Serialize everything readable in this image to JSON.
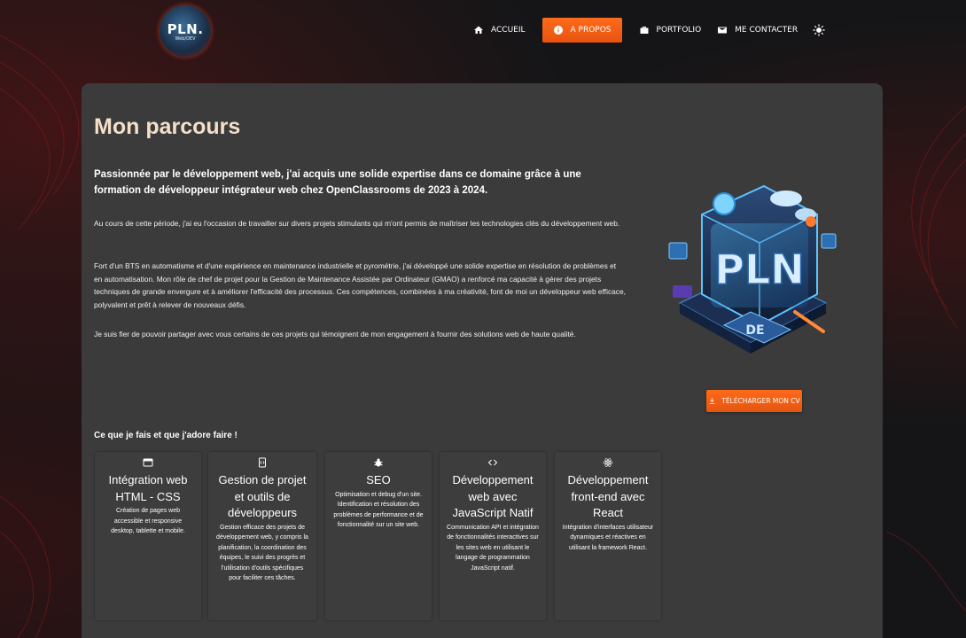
{
  "logo": {
    "text": "PLN.",
    "subtext": "Web/DEV"
  },
  "nav": {
    "items": [
      {
        "label": "ACCUEIL",
        "icon": "home-icon"
      },
      {
        "label": "A PROPOS",
        "icon": "info-icon",
        "active": true
      },
      {
        "label": "PORTFOLIO",
        "icon": "briefcase-icon"
      },
      {
        "label": "ME CONTACTER",
        "icon": "mail-icon"
      }
    ],
    "theme_toggle_icon": "sun-icon"
  },
  "about": {
    "title": "Mon parcours",
    "lead": "Passionnée par le développement web, j'ai acquis une solide expertise dans ce domaine grâce à une formation de développeur intégrateur web chez OpenClassrooms de 2023 à 2024.",
    "paragraphs": [
      "Au cours de cette période, j'ai eu l'occasion de travailler sur divers projets stimulants qui m'ont permis de maîtriser les technologies clés du développement web.",
      "Fort d'un BTS en automatisme et d'une expérience en maintenance industrielle et pyrométrie, j'ai développé une solide expertise en résolution de problèmes et en automatisation. Mon rôle de chef de projet pour la Gestion de Maintenance Assistée par Ordinateur (GMAO) a renforcé ma capacité à gérer des projets techniques de grande envergure et à améliorer l'efficacité des processus. Ces compétences, combinées à ma créativité, font de moi un développeur web efficace, polyvalent et prêt à relever de nouveaux défis.",
      "Je suis fier de pouvoir partager avec vous certains de ces projets qui témoignent de mon engagement à fournir des solutions web de haute qualité."
    ],
    "illustration_text": {
      "main": "PLN",
      "badge": "DE"
    },
    "cv_button": "TÉLÉCHARGER MON CV"
  },
  "skills": {
    "heading": "Ce que je fais et que j'adore faire !",
    "items": [
      {
        "icon": "browser-icon",
        "title": "Intégration web HTML - CSS",
        "desc": "Création de pages web accessible et responsive desktop, tablette et mobile."
      },
      {
        "icon": "code-device-icon",
        "title": "Gestion de projet et outils de développeurs",
        "desc": "Gestion efficace des projets de développement web, y compris la planification, la coordination des équipes, le suivi des progrès et l'utilisation d'outils spécifiques pour faciliter ces tâches."
      },
      {
        "icon": "bug-icon",
        "title": "SEO",
        "desc": "Optimisation et debug d'un site. Identification et résolution des problèmes de performance et de fonctionnalité sur un site web."
      },
      {
        "icon": "code-icon",
        "title": "Développement web avec JavaScript Natif",
        "desc": "Communication API et intégration de fonctionnalités interactives sur les sites web en utilisant le langage de programmation JavaScript natif."
      },
      {
        "icon": "react-icon",
        "title": "Développement front-end avec React",
        "desc": "Intégration d'interfaces utilisateur dynamiques et réactives en utilisant la framework React."
      }
    ]
  },
  "colors": {
    "accent": "#ff6a1a",
    "card": "#3b3b3c",
    "title": "#f4dfc9",
    "background": "#151517"
  }
}
